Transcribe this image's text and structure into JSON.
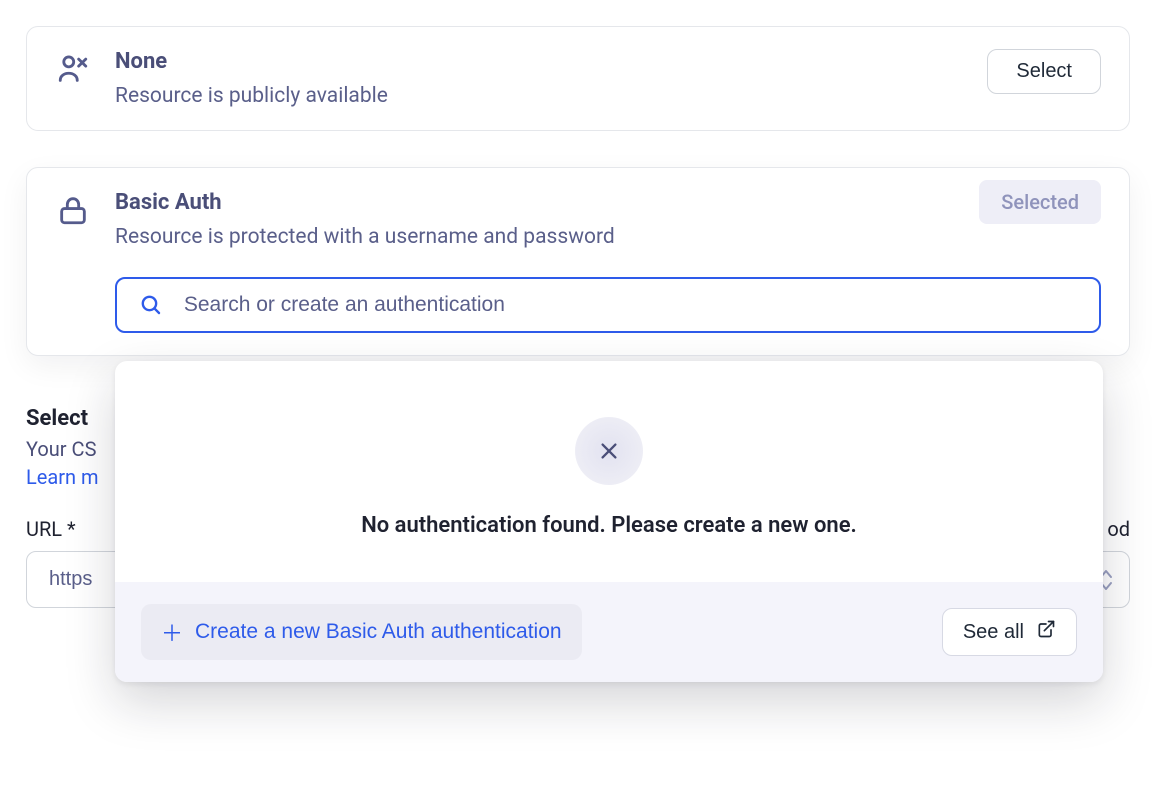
{
  "options": {
    "none": {
      "title": "None",
      "desc": "Resource is publicly available",
      "select_label": "Select"
    },
    "basic": {
      "title": "Basic Auth",
      "desc": "Resource is protected with a username and password",
      "selected_label": "Selected",
      "search_placeholder": "Search or create an authentication"
    }
  },
  "dropdown": {
    "empty_message": "No authentication found. Please create a new one.",
    "create_label": "Create a new Basic Auth authentication",
    "see_all_label": "See all"
  },
  "below": {
    "section_title_partial": "Select",
    "section_sub_partial": "Your CS",
    "learn_partial": "Learn m",
    "url_label": "URL *",
    "url_value_partial": "https",
    "method_label_partial": "od"
  }
}
